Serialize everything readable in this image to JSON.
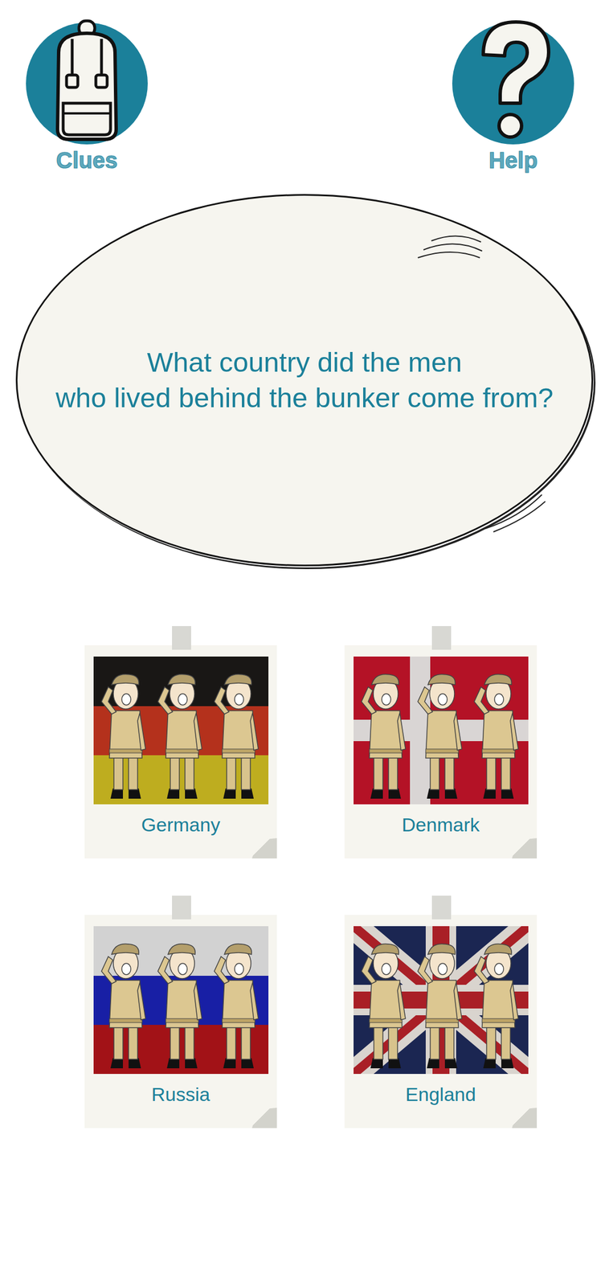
{
  "header": {
    "clues": {
      "label": "Clues"
    },
    "help": {
      "label": "Help"
    }
  },
  "question": {
    "lines": [
      "What country did the men",
      "who lived behind the bunker come from?"
    ]
  },
  "answers": [
    {
      "label": "Germany",
      "kind": "germany",
      "selected": false
    },
    {
      "label": "Denmark",
      "kind": "denmark",
      "selected": false
    },
    {
      "label": "Russia",
      "kind": "russia",
      "selected": false
    },
    {
      "label": "England",
      "kind": "england",
      "selected": false
    }
  ]
}
